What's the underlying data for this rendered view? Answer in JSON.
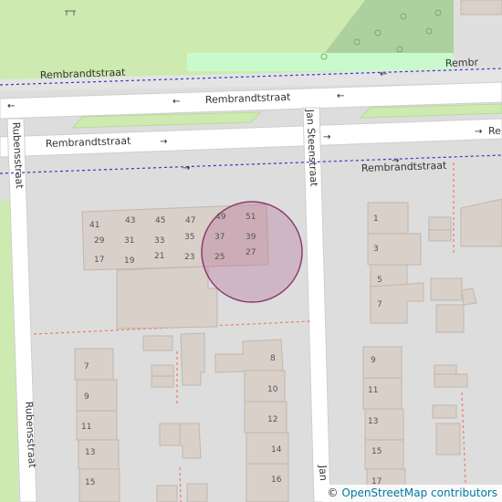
{
  "map": {
    "streets": {
      "rembrandt": "Rembrandtstraat",
      "rembrandt_partial": "Rembr",
      "rembrandt_right": "Re",
      "rubens": "Rubensstraat",
      "jan_steen": "Jan Steenstraat",
      "jan_steen_partial": "Jan"
    },
    "arrows": {
      "left": "←",
      "right": "→"
    },
    "house_numbers": {
      "n41": "41",
      "n43": "43",
      "n45": "45",
      "n47": "47",
      "n49": "49",
      "n51": "51",
      "n29": "29",
      "n31": "31",
      "n33": "33",
      "n35": "35",
      "n37": "37",
      "n39": "39",
      "n17": "17",
      "n19": "19",
      "n21": "21",
      "n23": "23",
      "n25": "25",
      "n27": "27",
      "e1": "1",
      "e3": "3",
      "e5": "5",
      "e7": "7",
      "w7": "7",
      "w9": "9",
      "w11": "11",
      "w13": "13",
      "w15": "15",
      "m8": "8",
      "m10": "10",
      "m12": "12",
      "m14": "14",
      "m16": "16",
      "r9": "9",
      "r11": "11",
      "r13": "13",
      "r15": "15",
      "r17": "17"
    },
    "colors": {
      "land": "#f2efe9",
      "residential": "#e0dfdf",
      "building": "#d9d0c9",
      "building_outline": "#c4b6ab",
      "grass": "#cdebb0",
      "wood": "#add19e",
      "road": "#ffffff",
      "circle_fill": "#b05c8f",
      "dashed_blue": "#2e3cc2",
      "dashed_red": "#f07a6a"
    }
  },
  "attribution": {
    "symbol": "©",
    "link_text": "OpenStreetMap contributors"
  }
}
